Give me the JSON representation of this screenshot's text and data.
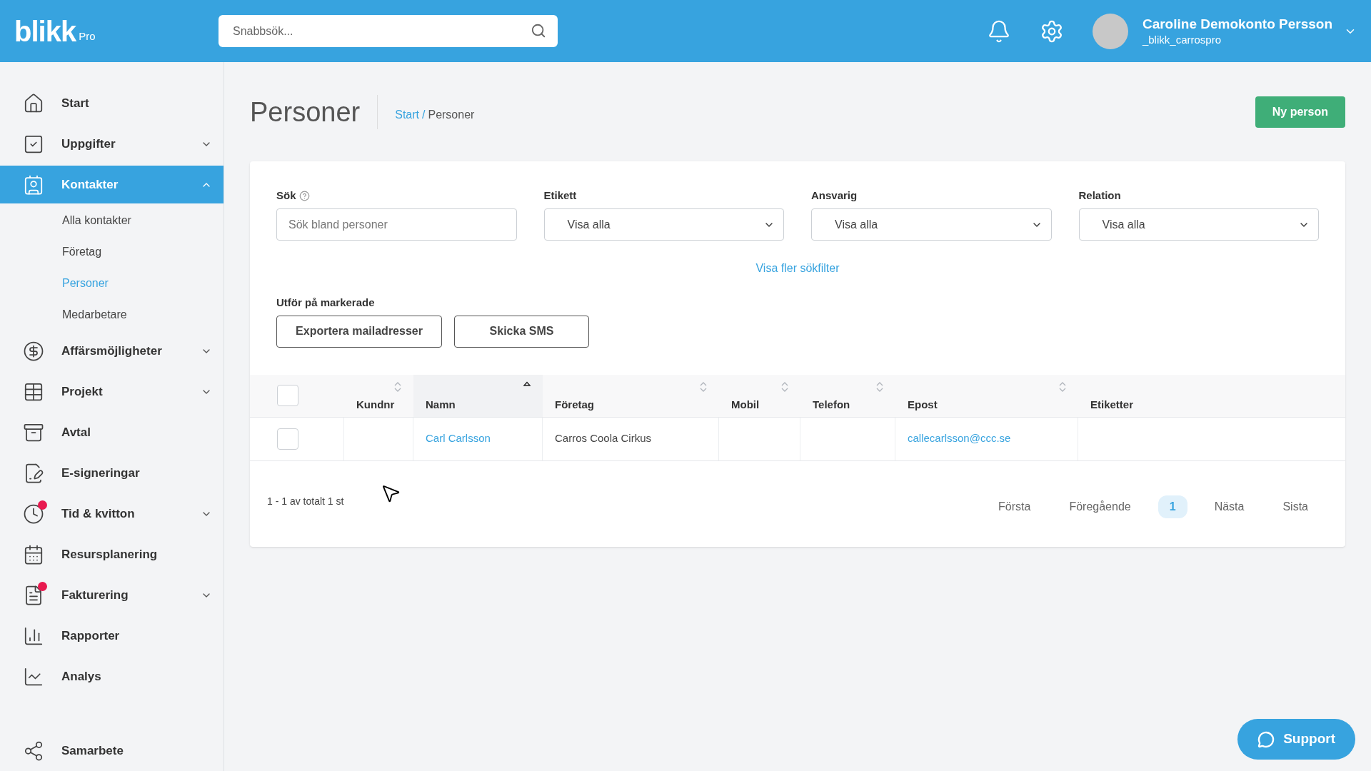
{
  "header": {
    "logo": "blikk",
    "logo_suffix": "Pro",
    "search": {
      "placeholder": "Snabbsök..."
    },
    "user": {
      "name": "Caroline Demokonto Persson",
      "username": "_blikk_carrospro"
    }
  },
  "sidebar": {
    "items": [
      {
        "label": "Start",
        "selected": false,
        "badge": false
      },
      {
        "label": "Uppgifter",
        "selected": false,
        "badge": false,
        "expanded": false
      },
      {
        "label": "Kontakter",
        "selected": true,
        "badge": false,
        "expanded": true,
        "children": [
          {
            "label": "Alla kontakter",
            "selected": false
          },
          {
            "label": "Företag",
            "selected": false
          },
          {
            "label": "Personer",
            "selected": true
          },
          {
            "label": "Medarbetare",
            "selected": false
          }
        ]
      },
      {
        "label": "Affärsmöjligheter",
        "selected": false,
        "badge": false,
        "expanded": false
      },
      {
        "label": "Projekt",
        "selected": false,
        "badge": false,
        "expanded": false
      },
      {
        "label": "Avtal",
        "selected": false,
        "badge": false
      },
      {
        "label": "E-signeringar",
        "selected": false,
        "badge": false
      },
      {
        "label": "Tid & kvitton",
        "selected": false,
        "badge": true,
        "expanded": false
      },
      {
        "label": "Resursplanering",
        "selected": false,
        "badge": false
      },
      {
        "label": "Fakturering",
        "selected": false,
        "badge": true,
        "expanded": false
      },
      {
        "label": "Rapporter",
        "selected": false,
        "badge": false
      },
      {
        "label": "Analys",
        "selected": false,
        "badge": false
      },
      {
        "label": "Samarbete",
        "selected": false,
        "badge": false
      }
    ]
  },
  "page": {
    "title": "Personer",
    "breadcrumb": [
      {
        "label": "Start",
        "link": true
      },
      {
        "label": "Personer",
        "link": false
      }
    ],
    "breadcrumb_separator": "/",
    "new_button": "Ny person"
  },
  "filters": [
    {
      "kind": "text",
      "label": "Sök",
      "help": true,
      "placeholder": "Sök bland personer"
    },
    {
      "kind": "select",
      "label": "Etikett",
      "help": false,
      "value": "Visa alla"
    },
    {
      "kind": "select",
      "label": "Ansvarig",
      "help": false,
      "value": "Visa alla"
    },
    {
      "kind": "select",
      "label": "Relation",
      "help": false,
      "value": "Visa alla"
    }
  ],
  "more_filters": "Visa fler sökfilter",
  "bulk": {
    "label": "Utför på markerade",
    "buttons": [
      "Exportera mailadresser",
      "Skicka SMS"
    ]
  },
  "table": {
    "all_checked": false,
    "columns": [
      {
        "label": "Kundnr",
        "sortable": true,
        "sorted": false
      },
      {
        "label": "Namn",
        "sortable": true,
        "sorted": true
      },
      {
        "label": "Företag",
        "sortable": true,
        "sorted": false
      },
      {
        "label": "Mobil",
        "sortable": true,
        "sorted": false
      },
      {
        "label": "Telefon",
        "sortable": true,
        "sorted": false
      },
      {
        "label": "Epost",
        "sortable": true,
        "sorted": false
      },
      {
        "label": "Etiketter",
        "sortable": false
      }
    ],
    "rows": [
      {
        "checked": false,
        "cells": [
          {
            "text": ""
          },
          {
            "text": "Carl Carlsson",
            "link": true
          },
          {
            "text": "Carros Coola Cirkus",
            "link": false
          },
          {
            "text": ""
          },
          {
            "text": ""
          },
          {
            "text": "callecarlsson@ccc.se",
            "link": true
          },
          {
            "text": ""
          }
        ]
      }
    ]
  },
  "summary": "1 - 1 av totalt 1 st",
  "pagination": [
    {
      "label": "Första",
      "selected": false
    },
    {
      "label": "Föregående",
      "selected": false
    },
    {
      "label": "1",
      "selected": true
    },
    {
      "label": "Nästa",
      "selected": false
    },
    {
      "label": "Sista",
      "selected": false
    }
  ],
  "support": "Support"
}
